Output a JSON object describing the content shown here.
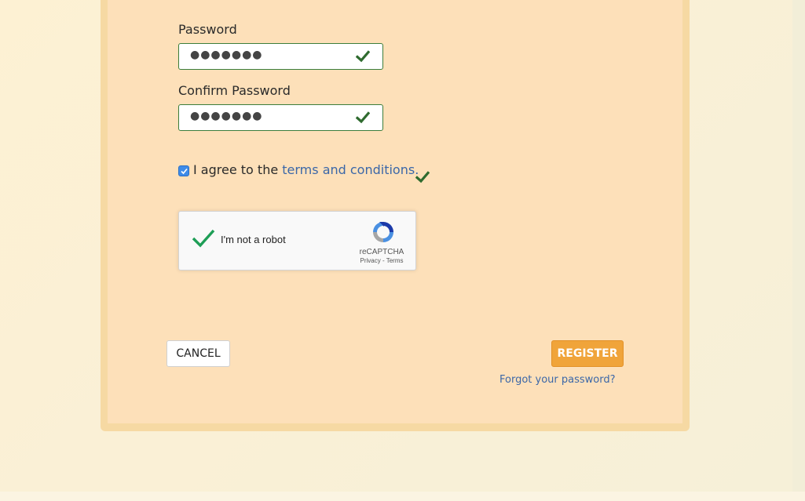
{
  "form": {
    "password_label": "Password",
    "password_value": "●●●●●●●",
    "confirm_label": "Confirm Password",
    "confirm_value": "●●●●●●●",
    "agree_prefix": "I agree to the ",
    "terms_link": "terms and conditions.",
    "agree_checked": true
  },
  "recaptcha": {
    "label": "I'm not a robot",
    "brand": "reCAPTCHA",
    "links": "Privacy - Terms"
  },
  "actions": {
    "cancel_label": "CANCEL",
    "register_label": "REGISTER",
    "forgot_label": "Forgot your password?"
  },
  "colors": {
    "valid": "#3b7d3b",
    "accent": "#f0a43a",
    "link": "#3b67a8"
  },
  "icons": {
    "valid": "check-icon",
    "recaptcha": "recaptcha-logo-icon"
  }
}
